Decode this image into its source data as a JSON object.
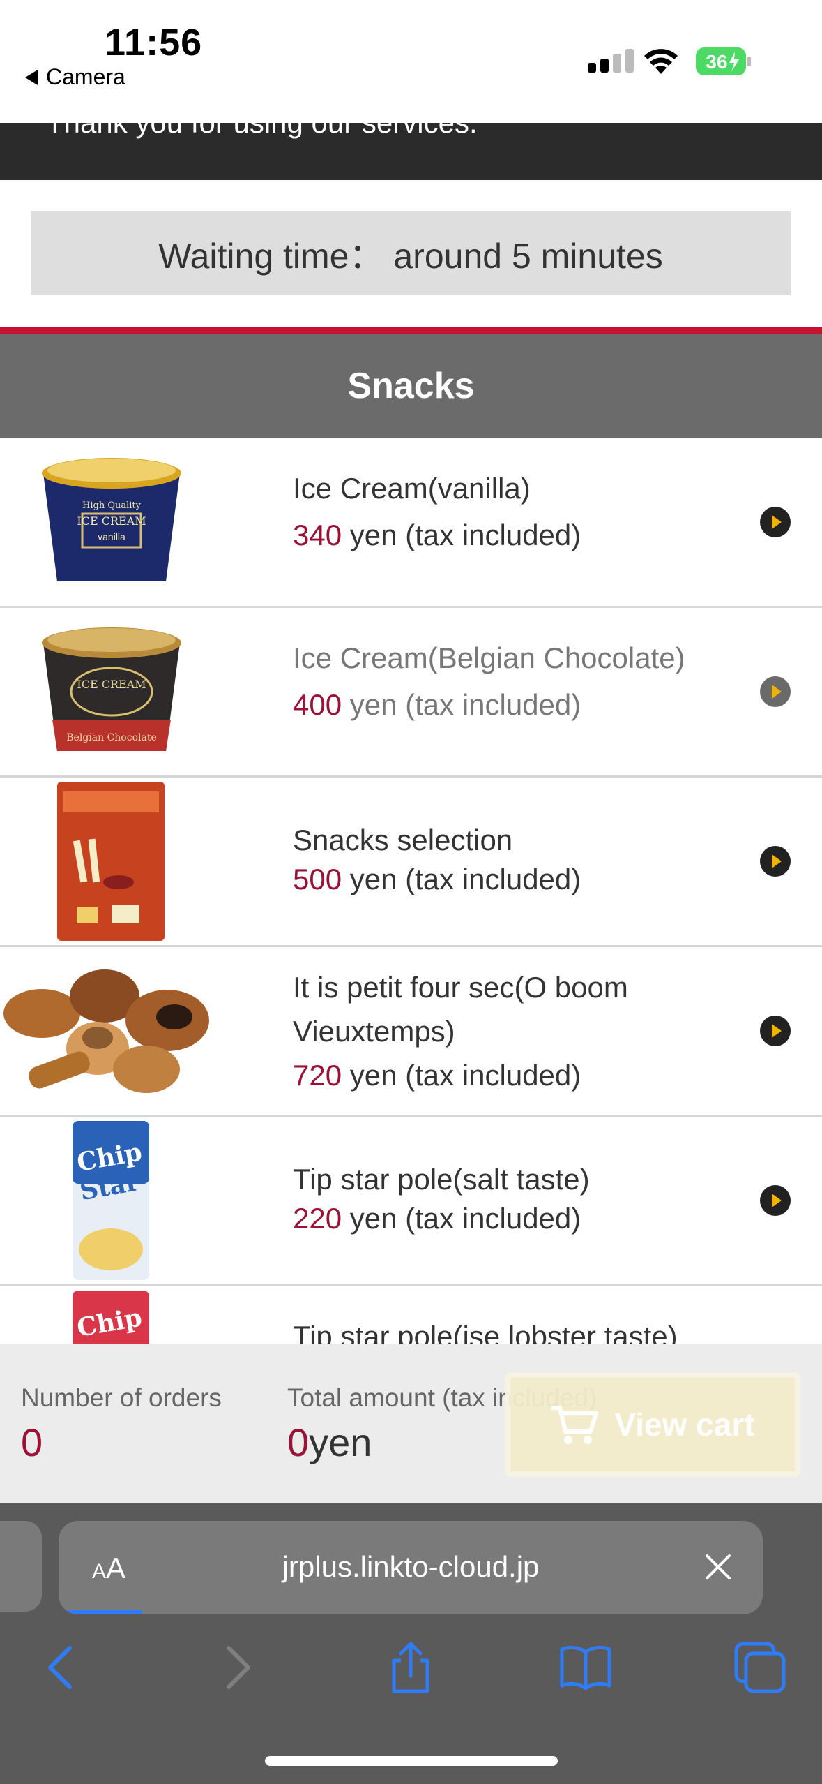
{
  "status_bar": {
    "time": "11:56",
    "back_app": "Camera",
    "battery": "36"
  },
  "banner": {
    "text": "Thank you for using our services."
  },
  "waiting": {
    "text": "Waiting time： around 5 minutes"
  },
  "section": {
    "title": "Snacks"
  },
  "products": [
    {
      "name": "Ice Cream(vanilla)",
      "price": "340",
      "price_suffix": " yen (tax included)",
      "image": "ice-cream-vanilla-cup"
    },
    {
      "name": "Ice Cream(Belgian Chocolate)",
      "price": "400",
      "price_suffix": " yen (tax included)",
      "image": "ice-cream-chocolate-cup"
    },
    {
      "name": "Snacks selection",
      "price": "500",
      "price_suffix": " yen (tax included)",
      "image": "snacks-selection-bag"
    },
    {
      "name": "It is petit four sec(O boom Vieuxtemps)",
      "price": "720",
      "price_suffix": " yen (tax included)",
      "image": "petit-four-cookies"
    },
    {
      "name": "Tip star pole(salt taste)",
      "price": "220",
      "price_suffix": " yen (tax included)",
      "image": "chip-star-salt-can"
    },
    {
      "name": "Tip star pole(ise lobster taste)",
      "price": "",
      "price_suffix": "",
      "image": "chip-star-lobster-can"
    }
  ],
  "order_bar": {
    "orders_label": "Number of orders",
    "orders_value": "0",
    "total_label": "Total amount (tax included)",
    "total_value": "0",
    "total_unit": "yen",
    "view_cart_label": "View cart"
  },
  "browser": {
    "aa_label_small": "A",
    "aa_label_large": "A",
    "url": "jrplus.linkto-cloud.jp"
  },
  "colors": {
    "accent_red": "#c4122f",
    "price_color": "#9a1236",
    "header_gray": "#6b6b6b",
    "safari_blue": "#2f7cf6"
  }
}
